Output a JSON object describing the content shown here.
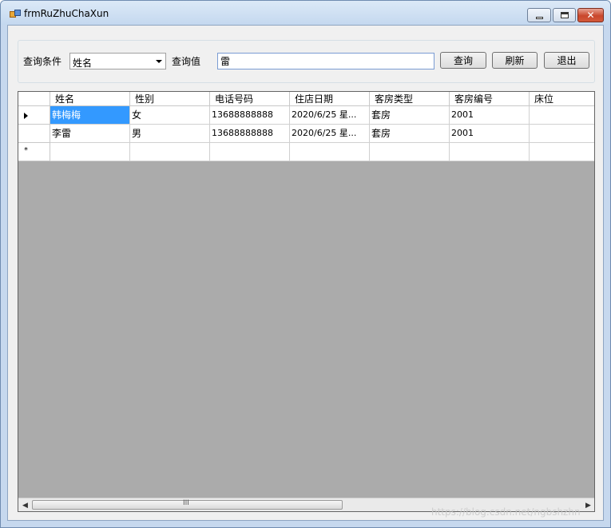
{
  "window": {
    "title": "frmRuZhuChaXun",
    "icons": {
      "app": "app-icon",
      "minimize": "minimize-icon",
      "maximize": "maximize-icon",
      "close": "close-icon"
    }
  },
  "query": {
    "condition_label": "查询条件",
    "condition_value": "姓名",
    "value_label": "查询值",
    "value_text": "雷",
    "search_button": "查询",
    "refresh_button": "刷新",
    "exit_button": "退出"
  },
  "grid": {
    "columns": [
      "姓名",
      "性别",
      "电话号码",
      "住店日期",
      "客房类型",
      "客房编号",
      "床位"
    ],
    "rows": [
      [
        "韩梅梅",
        "女",
        "13688888888",
        "2020/6/25 星...",
        "套房",
        "2001",
        ""
      ],
      [
        "李雷",
        "男",
        "13688888888",
        "2020/6/25 星...",
        "套房",
        "2001",
        ""
      ]
    ],
    "selected_row": 0,
    "new_row_marker": "*",
    "scrollbar_grip": "III"
  },
  "watermark": "https://blog.csdn.net/ngbshzhn"
}
